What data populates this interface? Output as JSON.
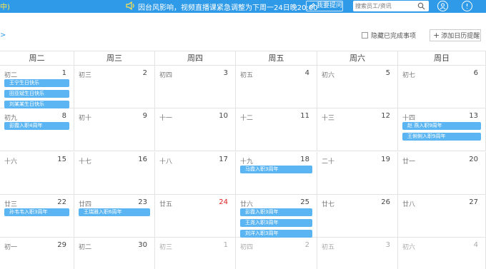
{
  "topbar": {
    "left_fragment": "中)",
    "notice": "因台风影响，视频直播课紧急调整为下周一24日晚20:00",
    "ask_label": "我要提问",
    "search_placeholder": "搜索员工/资讯",
    "icons": [
      "speaker-icon",
      "pen-icon",
      "search-icon",
      "user-icon",
      "help-icon"
    ]
  },
  "toolbar": {
    "prev_arrow": ">",
    "hide_completed_label": "隐藏已完成事项",
    "add_reminder_label": "添加日历提醒",
    "add_icon": "+"
  },
  "calendar": {
    "weekdays": [
      "周二",
      "周三",
      "周四",
      "周五",
      "周六",
      "周日"
    ],
    "weeks": [
      [
        {
          "lunar": "初二",
          "day": "1",
          "events": [
            "王宁生日快乐",
            "田亚斌生日快乐",
            "刘某某生日快乐"
          ]
        },
        {
          "lunar": "初三",
          "day": "2",
          "events": []
        },
        {
          "lunar": "初四",
          "day": "3",
          "events": []
        },
        {
          "lunar": "初五",
          "day": "4",
          "events": []
        },
        {
          "lunar": "初六",
          "day": "5",
          "events": []
        },
        {
          "lunar": "初七",
          "day": "6",
          "events": []
        }
      ],
      [
        {
          "lunar": "初九",
          "day": "8",
          "events": [
            "彭霞入职4周年"
          ]
        },
        {
          "lunar": "初十",
          "day": "9",
          "events": []
        },
        {
          "lunar": "十一",
          "day": "10",
          "events": []
        },
        {
          "lunar": "十二",
          "day": "11",
          "events": []
        },
        {
          "lunar": "十三",
          "day": "12",
          "events": []
        },
        {
          "lunar": "十四",
          "day": "13",
          "events": [
            "赵 燕入职9周年",
            "王俐俐入职9周年"
          ]
        }
      ],
      [
        {
          "lunar": "十六",
          "day": "15",
          "events": []
        },
        {
          "lunar": "十七",
          "day": "16",
          "events": []
        },
        {
          "lunar": "十八",
          "day": "17",
          "events": []
        },
        {
          "lunar": "十九",
          "day": "18",
          "events": [
            "马霞入职3周年"
          ]
        },
        {
          "lunar": "二十",
          "day": "19",
          "events": []
        },
        {
          "lunar": "廿一",
          "day": "20",
          "events": []
        }
      ],
      [
        {
          "lunar": "廿三",
          "day": "22",
          "events": [
            "孙韦韦入职3周年"
          ]
        },
        {
          "lunar": "廿四",
          "day": "23",
          "events": [
            "王瑞雅入职6周年"
          ]
        },
        {
          "lunar": "廿五",
          "day": "24",
          "events": []
        },
        {
          "lunar": "廿六",
          "day": "25",
          "events": [
            "彭霞入职3周年",
            "王尧入职3周年",
            "刘洋入职3周年"
          ]
        },
        {
          "lunar": "廿七",
          "day": "26",
          "events": []
        },
        {
          "lunar": "廿八",
          "day": "27",
          "events": []
        }
      ],
      [
        {
          "lunar": "初一",
          "day": "29",
          "events": []
        },
        {
          "lunar": "初二",
          "day": "30",
          "events": []
        },
        {
          "lunar": "初三",
          "day": "1",
          "events": []
        },
        {
          "lunar": "初四",
          "day": "2",
          "events": []
        },
        {
          "lunar": "初五",
          "day": "3",
          "events": []
        },
        {
          "lunar": "初六",
          "day": "4",
          "events": []
        }
      ]
    ],
    "highlight_days": [
      "24"
    ],
    "other_month_week_index": 4,
    "other_month_from_col": 2,
    "event_color": "#5bb5f2",
    "weekend_red": "#e02020"
  }
}
